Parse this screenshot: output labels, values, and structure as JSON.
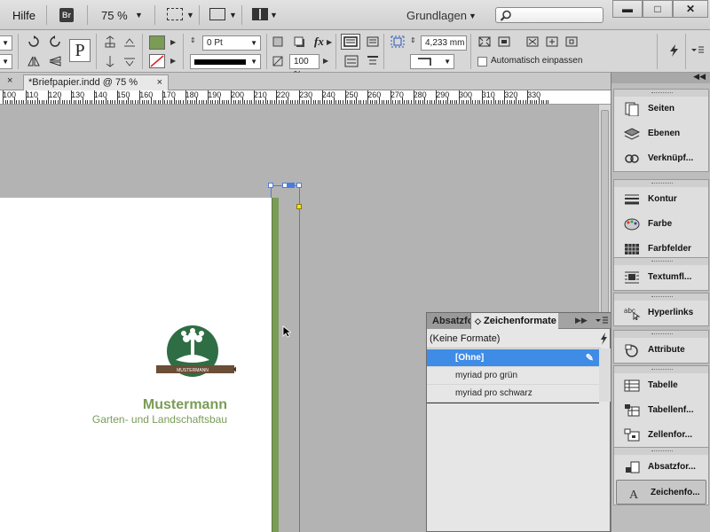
{
  "app_bar": {
    "menu_help": "Hilfe",
    "bridge_badge": "Br",
    "zoom": "75 %",
    "workspace": "Grundlagen",
    "search_placeholder": "",
    "window_minimize": "▬",
    "window_maximize": "□",
    "window_close": "✕"
  },
  "control_bar": {
    "fill_color": "#7a9c56",
    "stroke_weight": "0 Pt",
    "scale_value": "100 %",
    "dimension_value": "4,233 mm",
    "autofit_label": "Automatisch einpassen",
    "text_frame_label": "P"
  },
  "document": {
    "tab_close_left": "×",
    "tab_title": "*Briefpapier.indd @ 75 %",
    "tab_close": "×",
    "ruler_labels": [
      "100",
      "110",
      "120",
      "130",
      "140",
      "150",
      "160",
      "170",
      "180",
      "190",
      "200",
      "210",
      "220",
      "230",
      "240",
      "250",
      "260",
      "270",
      "280",
      "290",
      "300",
      "310",
      "320",
      "330"
    ]
  },
  "logo": {
    "name": "Mustermann",
    "subtitle": "Garten- und Landschaftsbau",
    "ribbon_text": "MUSTERMANN",
    "accent_color": "#7a9c56",
    "dark_green": "#2f6e45"
  },
  "char_styles_panel": {
    "tab_paragraph": "Absatzformate",
    "tab_character": "Zeichenformate",
    "header": "(Keine Formate)",
    "styles": [
      {
        "label": "[Ohne]",
        "selected": true
      },
      {
        "label": "myriad pro grün",
        "selected": false
      },
      {
        "label": "myriad pro schwarz",
        "selected": false
      }
    ]
  },
  "dock": {
    "group1": [
      {
        "icon": "pages-icon",
        "label": "Seiten"
      },
      {
        "icon": "layers-icon",
        "label": "Ebenen"
      },
      {
        "icon": "links-icon",
        "label": "Verknüpf..."
      }
    ],
    "group2": [
      {
        "icon": "stroke-icon",
        "label": "Kontur"
      },
      {
        "icon": "color-palette-icon",
        "label": "Farbe"
      },
      {
        "icon": "swatches-icon",
        "label": "Farbfelder"
      }
    ],
    "group3": [
      {
        "icon": "text-wrap-icon",
        "label": "Textumfl..."
      }
    ],
    "group4": [
      {
        "icon": "hyperlinks-icon",
        "label": "Hyperlinks"
      }
    ],
    "group5": [
      {
        "icon": "attributes-icon",
        "label": "Attribute"
      }
    ],
    "group6": [
      {
        "icon": "table-icon",
        "label": "Tabelle"
      },
      {
        "icon": "table-styles-icon",
        "label": "Tabellenf..."
      },
      {
        "icon": "cell-styles-icon",
        "label": "Zellenfor..."
      }
    ],
    "group7": [
      {
        "icon": "paragraph-styles-icon",
        "label": "Absatzfor..."
      },
      {
        "icon": "character-styles-icon",
        "label": "Zeichenfo..."
      }
    ]
  }
}
